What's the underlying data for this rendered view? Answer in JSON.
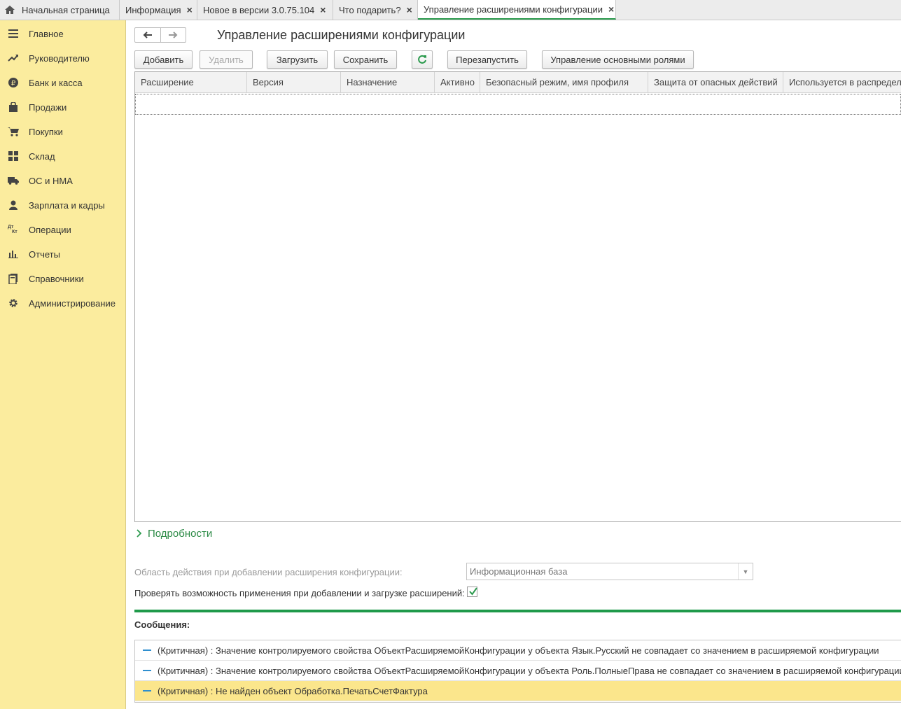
{
  "tabs": [
    {
      "label": "Начальная страница",
      "closable": false
    },
    {
      "label": "Информация",
      "closable": true
    },
    {
      "label": "Новое в версии 3.0.75.104",
      "closable": true
    },
    {
      "label": "Что подарить?",
      "closable": true
    },
    {
      "label": "Управление расширениями конфигурации",
      "closable": true,
      "active": true
    }
  ],
  "sidebar": {
    "items": [
      {
        "label": "Главное",
        "icon": "menu-icon"
      },
      {
        "label": "Руководителю",
        "icon": "trend-icon"
      },
      {
        "label": "Банк и касса",
        "icon": "ruble-icon"
      },
      {
        "label": "Продажи",
        "icon": "bag-icon"
      },
      {
        "label": "Покупки",
        "icon": "cart-icon"
      },
      {
        "label": "Склад",
        "icon": "warehouse-icon"
      },
      {
        "label": "ОС и НМА",
        "icon": "truck-icon"
      },
      {
        "label": "Зарплата и кадры",
        "icon": "person-icon"
      },
      {
        "label": "Операции",
        "icon": "dt-kt-icon"
      },
      {
        "label": "Отчеты",
        "icon": "bar-chart-icon"
      },
      {
        "label": "Справочники",
        "icon": "books-icon"
      },
      {
        "label": "Администрирование",
        "icon": "gear-icon"
      }
    ],
    "dt_label": "Дт",
    "kt_label": "Кт"
  },
  "page": {
    "title": "Управление расширениями конфигурации"
  },
  "toolbar": {
    "add": "Добавить",
    "delete": "Удалить",
    "load": "Загрузить",
    "save": "Сохранить",
    "restart": "Перезапустить",
    "roles": "Управление основными ролями"
  },
  "grid": {
    "columns": [
      "Расширение",
      "Версия",
      "Назначение",
      "Активно",
      "Безопасный режим, имя профиля",
      "Защита от опасных действий",
      "Используется в распределе"
    ]
  },
  "details": {
    "label": "Подробности"
  },
  "scope": {
    "label": "Область действия при добавлении расширения конфигурации:",
    "value": "Информационная база"
  },
  "check": {
    "label": "Проверять возможность применения при добавлении и загрузке расширений:",
    "checked": true
  },
  "messages": {
    "title": "Сообщения:",
    "items": [
      "(Критичная) : Значение контролируемого свойства ОбъектРасширяемойКонфигурации у объекта Язык.Русский не совпадает со значением в расширяемой конфигурации",
      "(Критичная) : Значение контролируемого свойства ОбъектРасширяемойКонфигурации у объекта Роль.ПолныеПрава не совпадает со значением в расширяемой конфигурации",
      "(Критичная) : Не найден объект Обработка.ПечатьСчетФактура"
    ]
  },
  "colors": {
    "sidebar_bg": "#fbec9e",
    "accent_green": "#2b9a4d",
    "selected_row": "#fbe68c",
    "message_dash": "#2f8fcf"
  }
}
